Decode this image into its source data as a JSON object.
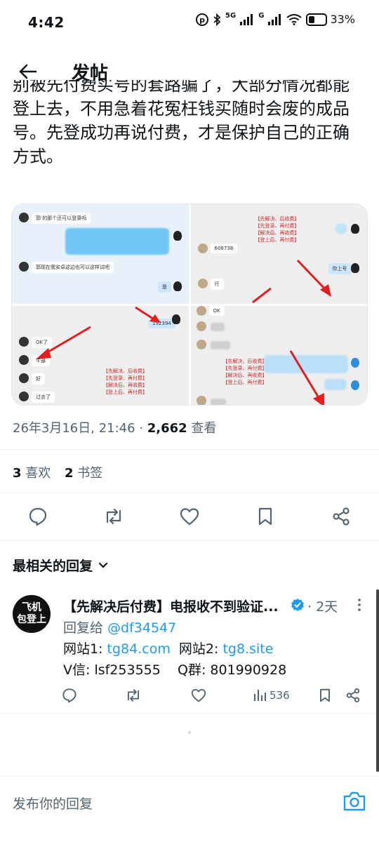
{
  "status": {
    "time": "4:42",
    "net1": "5G",
    "net2": "G",
    "battery": "33%"
  },
  "header": {
    "title": "发帖"
  },
  "post": {
    "lines": [
      "别被先付费买号的套路骗了，大部分情况都能",
      "登上去，不用急着花冤枉钱买随时会废的成品",
      "号。先登成功再说付费，才是保护自己的正确",
      "方式。"
    ],
    "media": {
      "tile1": {
        "top_msg": "郭      的那个还可以登录吗",
        "mid_msg": "郭现在我安卓这边也可以这样试吧",
        "reply": "是"
      },
      "tile2": {
        "code_a": "608738",
        "msg_b": "行",
        "msg_c": "你上号",
        "notes": [
          "【先解决、后收费】",
          "【先登录、再付费】",
          "【解决后、再收费】",
          "【登上后、再付费】"
        ]
      },
      "tile3": {
        "code": "192394",
        "msg1": "OK了",
        "msg2": "牛逼",
        "msg3": "好",
        "msg4": "过去了",
        "notes": [
          "【先解决、后收费】",
          "【先登录、再付费】",
          "【解决后、再收费】",
          "【登上后、再付费】"
        ]
      },
      "tile4": {
        "msg1": "OK",
        "notes": [
          "【先解决、后收费】",
          "【先登录、再付费】",
          "【解决后、再收费】",
          "【登上后、再付费】"
        ]
      }
    },
    "timestamp": "26年3月16日, 21:46 · ",
    "views_count": "2,662",
    "views_label": " 查看",
    "likes_count": "3",
    "likes_label": "喜欢",
    "bookmarks_count": "2",
    "bookmarks_label": "书签"
  },
  "replies": {
    "section_title": "最相关的回复",
    "reply": {
      "avatar_line1": "飞机",
      "avatar_line2": "包登上",
      "name": "【先解决后付费】电报收不到验证...",
      "time": "· 2天",
      "reply_to_label": "回复给 ",
      "reply_to_handle": "@df34547",
      "site1_label": "网站1: ",
      "site1_link": "tg84.com",
      "site2_label": "  网站2: ",
      "site2_link": "tg8.site",
      "contact": "V信: lsf253555    Q群: 801990928",
      "views": "536"
    }
  },
  "compose": {
    "placeholder": "发布你的回复"
  },
  "colors": {
    "accent": "#1d9bf0",
    "text": "#0f1419",
    "muted": "#536471",
    "annotation_red": "#d62828"
  }
}
